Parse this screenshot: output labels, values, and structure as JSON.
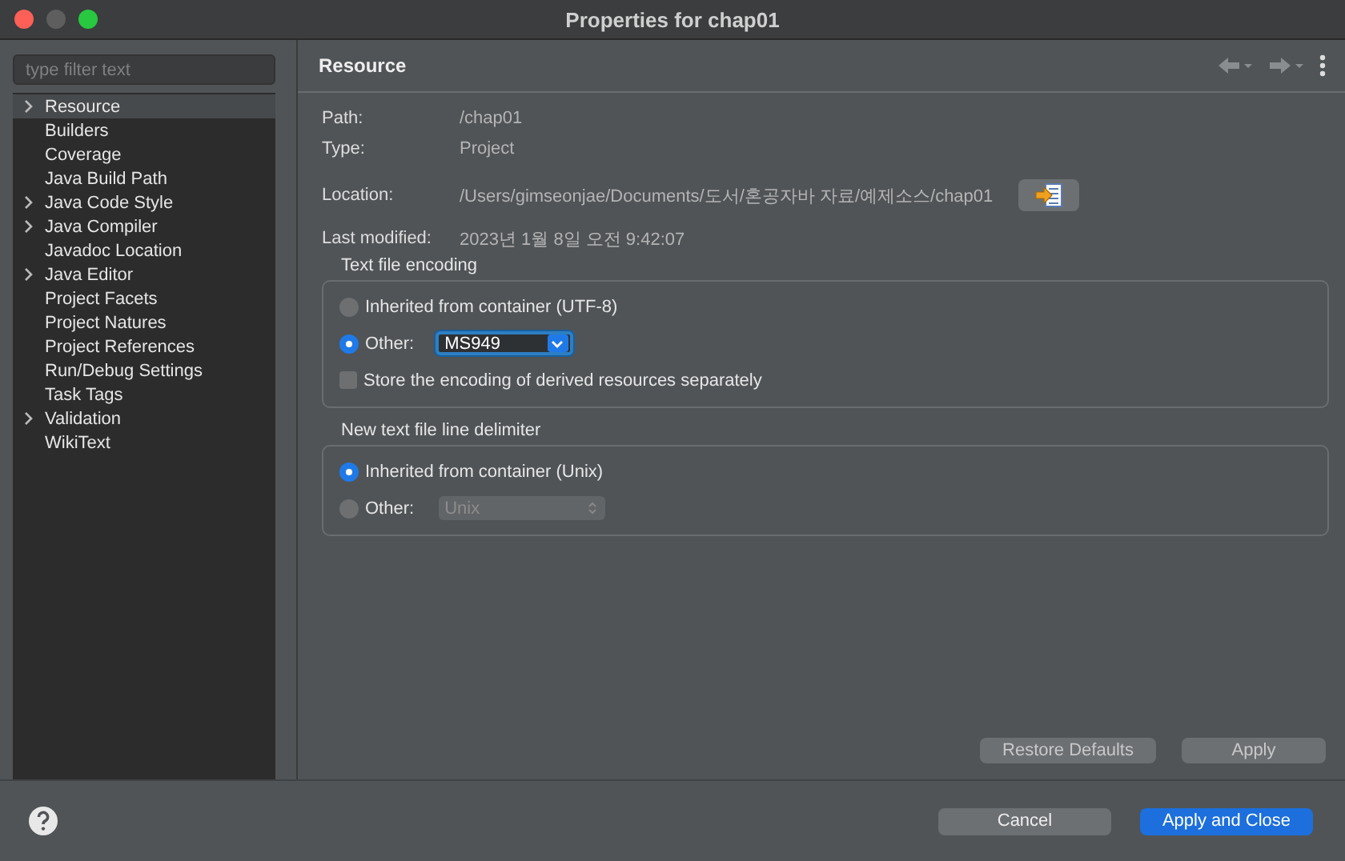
{
  "window": {
    "title": "Properties for chap01"
  },
  "filter": {
    "placeholder": "type filter text"
  },
  "tree": [
    {
      "label": "Resource",
      "expandable": true,
      "selected": true
    },
    {
      "label": "Builders",
      "expandable": false,
      "selected": false
    },
    {
      "label": "Coverage",
      "expandable": false,
      "selected": false
    },
    {
      "label": "Java Build Path",
      "expandable": false,
      "selected": false
    },
    {
      "label": "Java Code Style",
      "expandable": true,
      "selected": false
    },
    {
      "label": "Java Compiler",
      "expandable": true,
      "selected": false
    },
    {
      "label": "Javadoc Location",
      "expandable": false,
      "selected": false
    },
    {
      "label": "Java Editor",
      "expandable": true,
      "selected": false
    },
    {
      "label": "Project Facets",
      "expandable": false,
      "selected": false
    },
    {
      "label": "Project Natures",
      "expandable": false,
      "selected": false
    },
    {
      "label": "Project References",
      "expandable": false,
      "selected": false
    },
    {
      "label": "Run/Debug Settings",
      "expandable": false,
      "selected": false
    },
    {
      "label": "Task Tags",
      "expandable": false,
      "selected": false
    },
    {
      "label": "Validation",
      "expandable": true,
      "selected": false
    },
    {
      "label": "WikiText",
      "expandable": false,
      "selected": false
    }
  ],
  "page": {
    "title": "Resource",
    "info": [
      {
        "label": "Path:",
        "value": "/chap01"
      },
      {
        "label": "Type:",
        "value": "Project"
      },
      {
        "label": "Location:",
        "value": "/Users/gimseonjae/Documents/도서/혼공자바 자료/예제소스/chap01"
      },
      {
        "label": "Last modified:",
        "value": "2023년 1월 8일 오전 9:42:07"
      }
    ],
    "groups": [
      {
        "title": "Text file encoding",
        "options": [
          {
            "kind": "radio",
            "label": "Inherited from container (UTF-8)",
            "selected": false
          },
          {
            "kind": "radio",
            "label": "Other:",
            "selected": true,
            "combo": "MS949",
            "disabled": false
          },
          {
            "kind": "checkbox",
            "label": "Store the encoding of derived resources separately",
            "checked": false
          }
        ]
      },
      {
        "title": "New text file line delimiter",
        "options": [
          {
            "kind": "radio",
            "label": "Inherited from container (Unix)",
            "selected": true
          },
          {
            "kind": "radio",
            "label": "Other:",
            "selected": false,
            "combo": "Unix",
            "disabled": true
          }
        ]
      }
    ],
    "buttons": [
      "Restore Defaults",
      "Apply"
    ]
  },
  "footer": {
    "buttons": [
      {
        "label": "Cancel",
        "primary": false
      },
      {
        "label": "Apply and Close",
        "primary": true
      }
    ]
  }
}
